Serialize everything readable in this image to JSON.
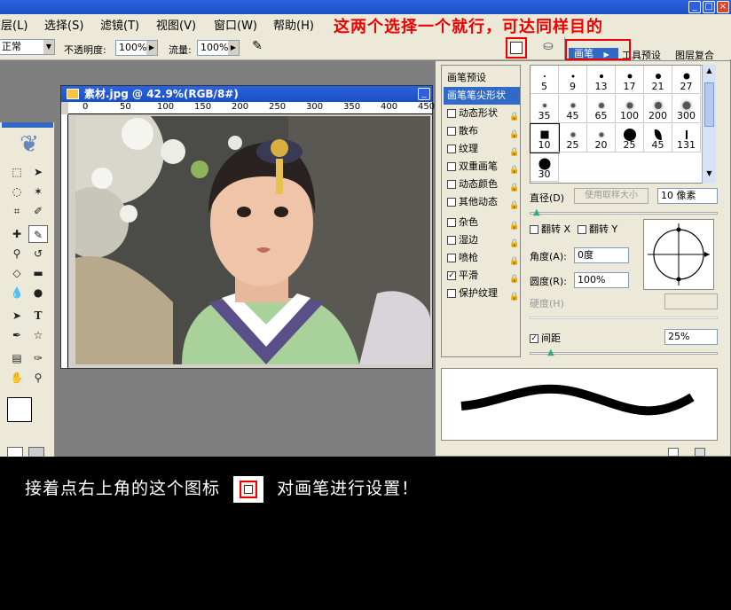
{
  "annotation_top": "这两个选择一个就行，可达同样目的",
  "caption": {
    "before": "接着点右上角的这个图标",
    "after": "对画笔进行设置！"
  },
  "menu": [
    "图层(L)",
    "选择(S)",
    "滤镜(T)",
    "视图(V)",
    "窗口(W)",
    "帮助(H)"
  ],
  "options": {
    "mode_value": "正常",
    "opacity_label": "不透明度:",
    "opacity_value": "100%",
    "flow_label": "流量:",
    "flow_value": "100%"
  },
  "palette_tabs": [
    "画笔",
    "工具预设",
    "图层复合"
  ],
  "document": {
    "title": "素材.jpg @ 42.9%(RGB/8#)",
    "ruler_ticks": [
      "0",
      "50",
      "100",
      "150",
      "200",
      "250",
      "300",
      "350",
      "400",
      "450"
    ]
  },
  "brush_panel": {
    "list": [
      {
        "label": "画笔预设",
        "check": false,
        "checked": false,
        "lock": false,
        "selected": false
      },
      {
        "label": "画笔笔尖形状",
        "check": false,
        "checked": false,
        "lock": false,
        "selected": true
      },
      {
        "label": "动态形状",
        "check": true,
        "checked": false,
        "lock": true,
        "selected": false
      },
      {
        "label": "散布",
        "check": true,
        "checked": false,
        "lock": true,
        "selected": false
      },
      {
        "label": "纹理",
        "check": true,
        "checked": false,
        "lock": true,
        "selected": false
      },
      {
        "label": "双重画笔",
        "check": true,
        "checked": false,
        "lock": true,
        "selected": false
      },
      {
        "label": "动态颜色",
        "check": true,
        "checked": false,
        "lock": true,
        "selected": false
      },
      {
        "label": "其他动态",
        "check": true,
        "checked": false,
        "lock": true,
        "selected": false
      },
      {
        "label": "杂色",
        "check": true,
        "checked": false,
        "lock": true,
        "selected": false
      },
      {
        "label": "湿边",
        "check": true,
        "checked": false,
        "lock": true,
        "selected": false
      },
      {
        "label": "喷枪",
        "check": true,
        "checked": false,
        "lock": true,
        "selected": false
      },
      {
        "label": "平滑",
        "check": true,
        "checked": true,
        "lock": true,
        "selected": false
      },
      {
        "label": "保护纹理",
        "check": true,
        "checked": false,
        "lock": true,
        "selected": false
      }
    ],
    "tips": [
      {
        "size": "5",
        "kind": "hard",
        "d": 2
      },
      {
        "size": "9",
        "kind": "hard",
        "d": 3
      },
      {
        "size": "13",
        "kind": "hard",
        "d": 4
      },
      {
        "size": "17",
        "kind": "hard",
        "d": 5
      },
      {
        "size": "21",
        "kind": "hard",
        "d": 6
      },
      {
        "size": "27",
        "kind": "hard",
        "d": 7
      },
      {
        "size": "35",
        "kind": "soft",
        "d": 4
      },
      {
        "size": "45",
        "kind": "soft",
        "d": 5
      },
      {
        "size": "65",
        "kind": "soft",
        "d": 6
      },
      {
        "size": "100",
        "kind": "soft",
        "d": 7
      },
      {
        "size": "200",
        "kind": "soft",
        "d": 8
      },
      {
        "size": "300",
        "kind": "soft",
        "d": 9
      },
      {
        "size": "10",
        "kind": "square",
        "d": 9
      },
      {
        "size": "25",
        "kind": "soft",
        "d": 5
      },
      {
        "size": "20",
        "kind": "soft",
        "d": 5
      },
      {
        "size": "25",
        "kind": "hard",
        "d": 14
      },
      {
        "size": "45",
        "kind": "leaf",
        "d": 12
      },
      {
        "size": "131",
        "kind": "grass",
        "d": 10
      },
      {
        "size": "30",
        "kind": "hard",
        "d": 13
      }
    ],
    "diameter_label": "直径(D)",
    "use_sample_label": "使用取样大小",
    "diameter_value": "10 像素",
    "flip_x_label": "翻转 X",
    "flip_y_label": "翻转 Y",
    "angle_label": "角度(A):",
    "angle_value": "0度",
    "roundness_label": "圆度(R):",
    "roundness_value": "100%",
    "hardness_label": "硬度(H)",
    "spacing_label": "间距",
    "spacing_value": "25%"
  }
}
